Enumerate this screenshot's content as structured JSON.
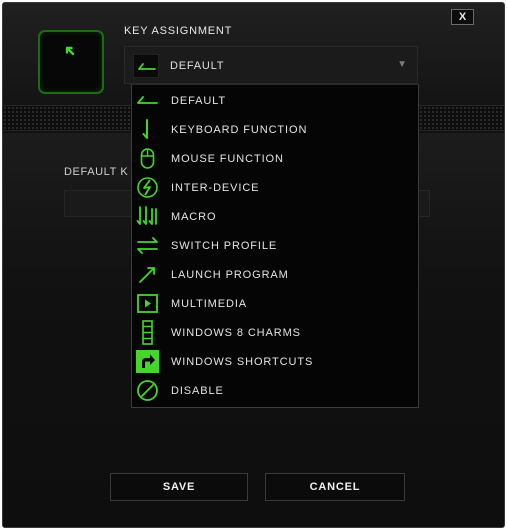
{
  "window": {
    "close_label": "X"
  },
  "key_assignment": {
    "title": "KEY ASSIGNMENT",
    "selected_value": "DEFAULT",
    "caret": "▼",
    "options": [
      {
        "label": "DEFAULT",
        "icon": "default-arrow-icon"
      },
      {
        "label": "KEYBOARD FUNCTION",
        "icon": "keyboard-function-icon"
      },
      {
        "label": "MOUSE FUNCTION",
        "icon": "mouse-icon"
      },
      {
        "label": "INTER-DEVICE",
        "icon": "inter-device-icon"
      },
      {
        "label": "MACRO",
        "icon": "macro-icon"
      },
      {
        "label": "SWITCH PROFILE",
        "icon": "switch-profile-icon"
      },
      {
        "label": "LAUNCH PROGRAM",
        "icon": "launch-program-icon"
      },
      {
        "label": "MULTIMEDIA",
        "icon": "multimedia-icon"
      },
      {
        "label": "WINDOWS 8 CHARMS",
        "icon": "windows-8-charms-icon"
      },
      {
        "label": "WINDOWS SHORTCUTS",
        "icon": "windows-shortcuts-icon"
      },
      {
        "label": "DISABLE",
        "icon": "disable-icon"
      }
    ]
  },
  "default_key": {
    "label": "DEFAULT K"
  },
  "footer": {
    "save_label": "SAVE",
    "cancel_label": "CANCEL"
  },
  "colors": {
    "accent": "#44d62c",
    "background": "#111111"
  }
}
